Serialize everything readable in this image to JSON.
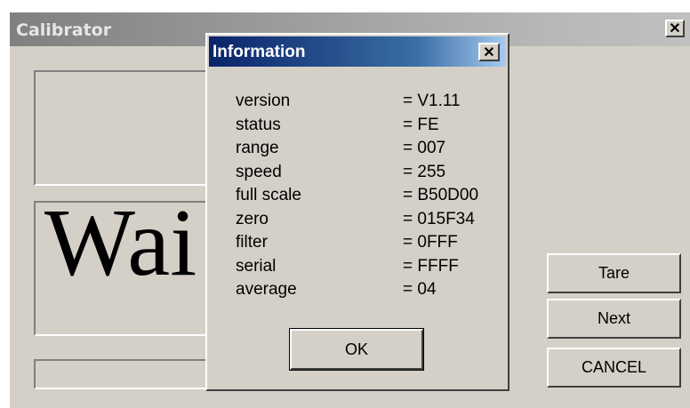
{
  "main_window": {
    "title": "Calibrator",
    "close_glyph": "✕",
    "status_text": "Wai",
    "buttons": {
      "tare": "Tare",
      "next": "Next",
      "cancel": "CANCEL"
    }
  },
  "info_dialog": {
    "title": "Information",
    "close_glyph": "✕",
    "rows": [
      {
        "key": "version",
        "value": "= V1.11"
      },
      {
        "key": "status",
        "value": "= FE"
      },
      {
        "key": "range",
        "value": "= 007"
      },
      {
        "key": "speed",
        "value": "= 255"
      },
      {
        "key": "full scale",
        "value": "= B50D00"
      },
      {
        "key": "zero",
        "value": "= 015F34"
      },
      {
        "key": "filter",
        "value": "= 0FFF"
      },
      {
        "key": "serial",
        "value": "= FFFF"
      },
      {
        "key": "average",
        "value": "= 04"
      }
    ],
    "ok_label": "OK"
  },
  "colors": {
    "face": "#d4d0c8",
    "active_title_start": "#0a246a",
    "active_title_end": "#a6caf0",
    "inactive_title": "#808080"
  }
}
